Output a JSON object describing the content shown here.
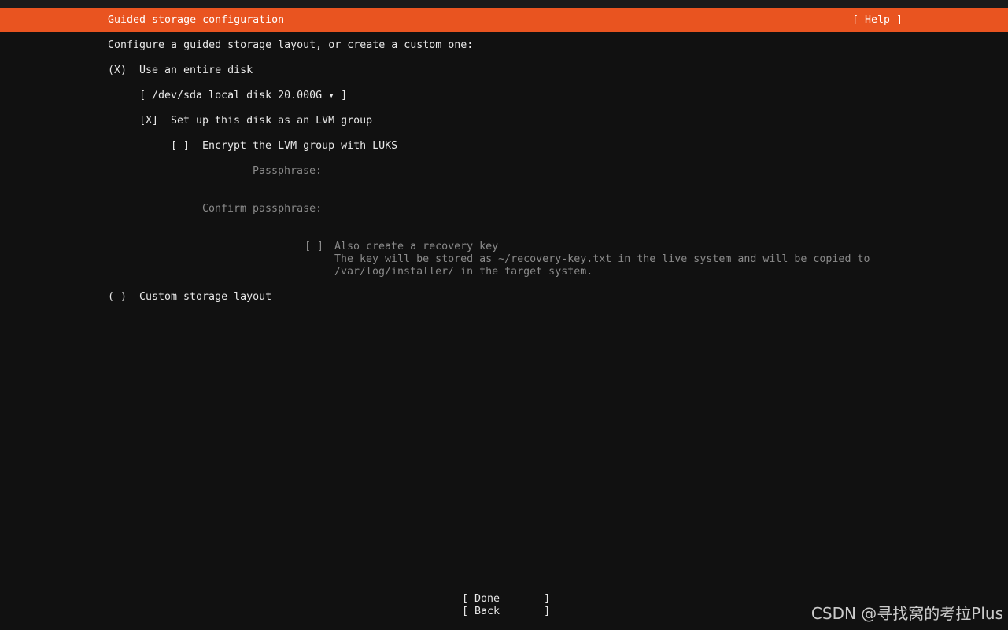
{
  "header": {
    "title": "Guided storage configuration",
    "help": "[ Help ]"
  },
  "intro": "Configure a guided storage layout, or create a custom one:",
  "entire_disk": {
    "radio": "(X)",
    "label": "Use an entire disk",
    "disk_select": "[ /dev/sda local disk 20.000G ▾ ]",
    "lvm": {
      "checkbox": "[X]",
      "label": "Set up this disk as an LVM group"
    },
    "encrypt": {
      "checkbox": "[ ]",
      "label": "Encrypt the LVM group with LUKS"
    },
    "passphrase": {
      "label": "Passphrase:",
      "value": ""
    },
    "confirm_passphrase": {
      "label": "Confirm passphrase:",
      "value": ""
    },
    "recovery": {
      "checkbox": "[ ]",
      "label": "Also create a recovery key",
      "desc_line1": "The key will be stored as ~/recovery-key.txt in the live system and will be copied to",
      "desc_line2": "/var/log/installer/ in the target system."
    }
  },
  "custom": {
    "radio": "( )",
    "label": "Custom storage layout"
  },
  "footer": {
    "done": "[ Done       ]",
    "back": "[ Back       ]"
  },
  "watermark": "CSDN @寻找窝的考拉Plus",
  "colors": {
    "accent": "#E95420",
    "background": "#111111",
    "text": "#e8e8e8",
    "disabled": "#8a8a8a"
  }
}
